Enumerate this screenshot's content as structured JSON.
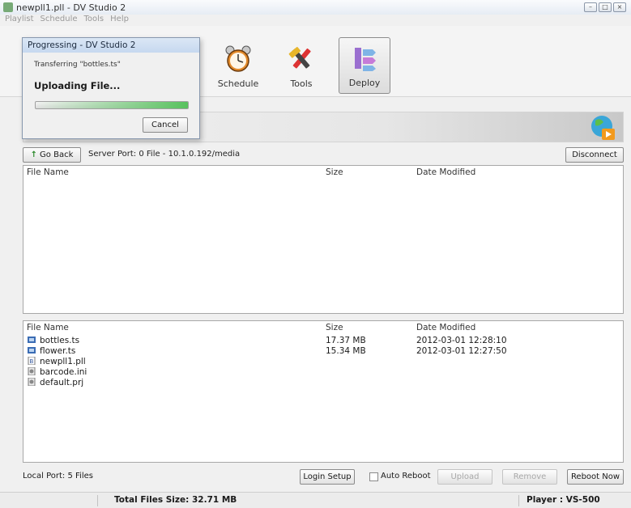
{
  "window": {
    "title": "newpll1.pll - DV Studio 2"
  },
  "menu": {
    "items": [
      {
        "label": "Playlist"
      },
      {
        "label": "Schedule"
      },
      {
        "label": "Tools"
      },
      {
        "label": "Help"
      }
    ]
  },
  "toolbar": {
    "schedule_label": "Schedule",
    "tools_label": "Tools",
    "deploy_label": "Deploy"
  },
  "nav": {
    "go_back_label": "Go Back",
    "server_port_text": "Server Port: 0 File - 10.1.0.192/media",
    "disconnect_label": "Disconnect"
  },
  "remote_panel": {
    "columns": {
      "name": "File Name",
      "size": "Size",
      "date": "Date Modified"
    },
    "rows": []
  },
  "local_panel": {
    "columns": {
      "name": "File Name",
      "size": "Size",
      "date": "Date Modified"
    },
    "rows": [
      {
        "name": "bottles.ts",
        "size": "17.37 MB",
        "date": "2012-03-01 12:28:10",
        "icon": "video-file-icon"
      },
      {
        "name": "flower.ts",
        "size": "15.34 MB",
        "date": "2012-03-01 12:27:50",
        "icon": "video-file-icon"
      },
      {
        "name": "newpll1.pll",
        "size": "",
        "date": "",
        "icon": "playlist-file-icon"
      },
      {
        "name": "barcode.ini",
        "size": "",
        "date": "",
        "icon": "config-file-icon"
      },
      {
        "name": "default.prj",
        "size": "",
        "date": "",
        "icon": "config-file-icon"
      }
    ]
  },
  "bottom": {
    "local_port_text": "Local Port: 5 Files",
    "login_setup_label": "Login Setup",
    "auto_reboot_label": "Auto Reboot",
    "auto_reboot_checked": false,
    "upload_label": "Upload",
    "remove_label": "Remove",
    "reboot_now_label": "Reboot Now"
  },
  "status": {
    "total_size": "Total Files Size: 32.71 MB",
    "player": "Player : VS-500"
  },
  "dialog": {
    "title": "Progressing - DV Studio 2",
    "transferring": "Transferring \"bottles.ts\"",
    "status": "Uploading File...",
    "progress_percent": 100,
    "cancel_label": "Cancel"
  },
  "colors": {
    "progress": "#58c25e",
    "title_bar": "#c6d8ef"
  }
}
